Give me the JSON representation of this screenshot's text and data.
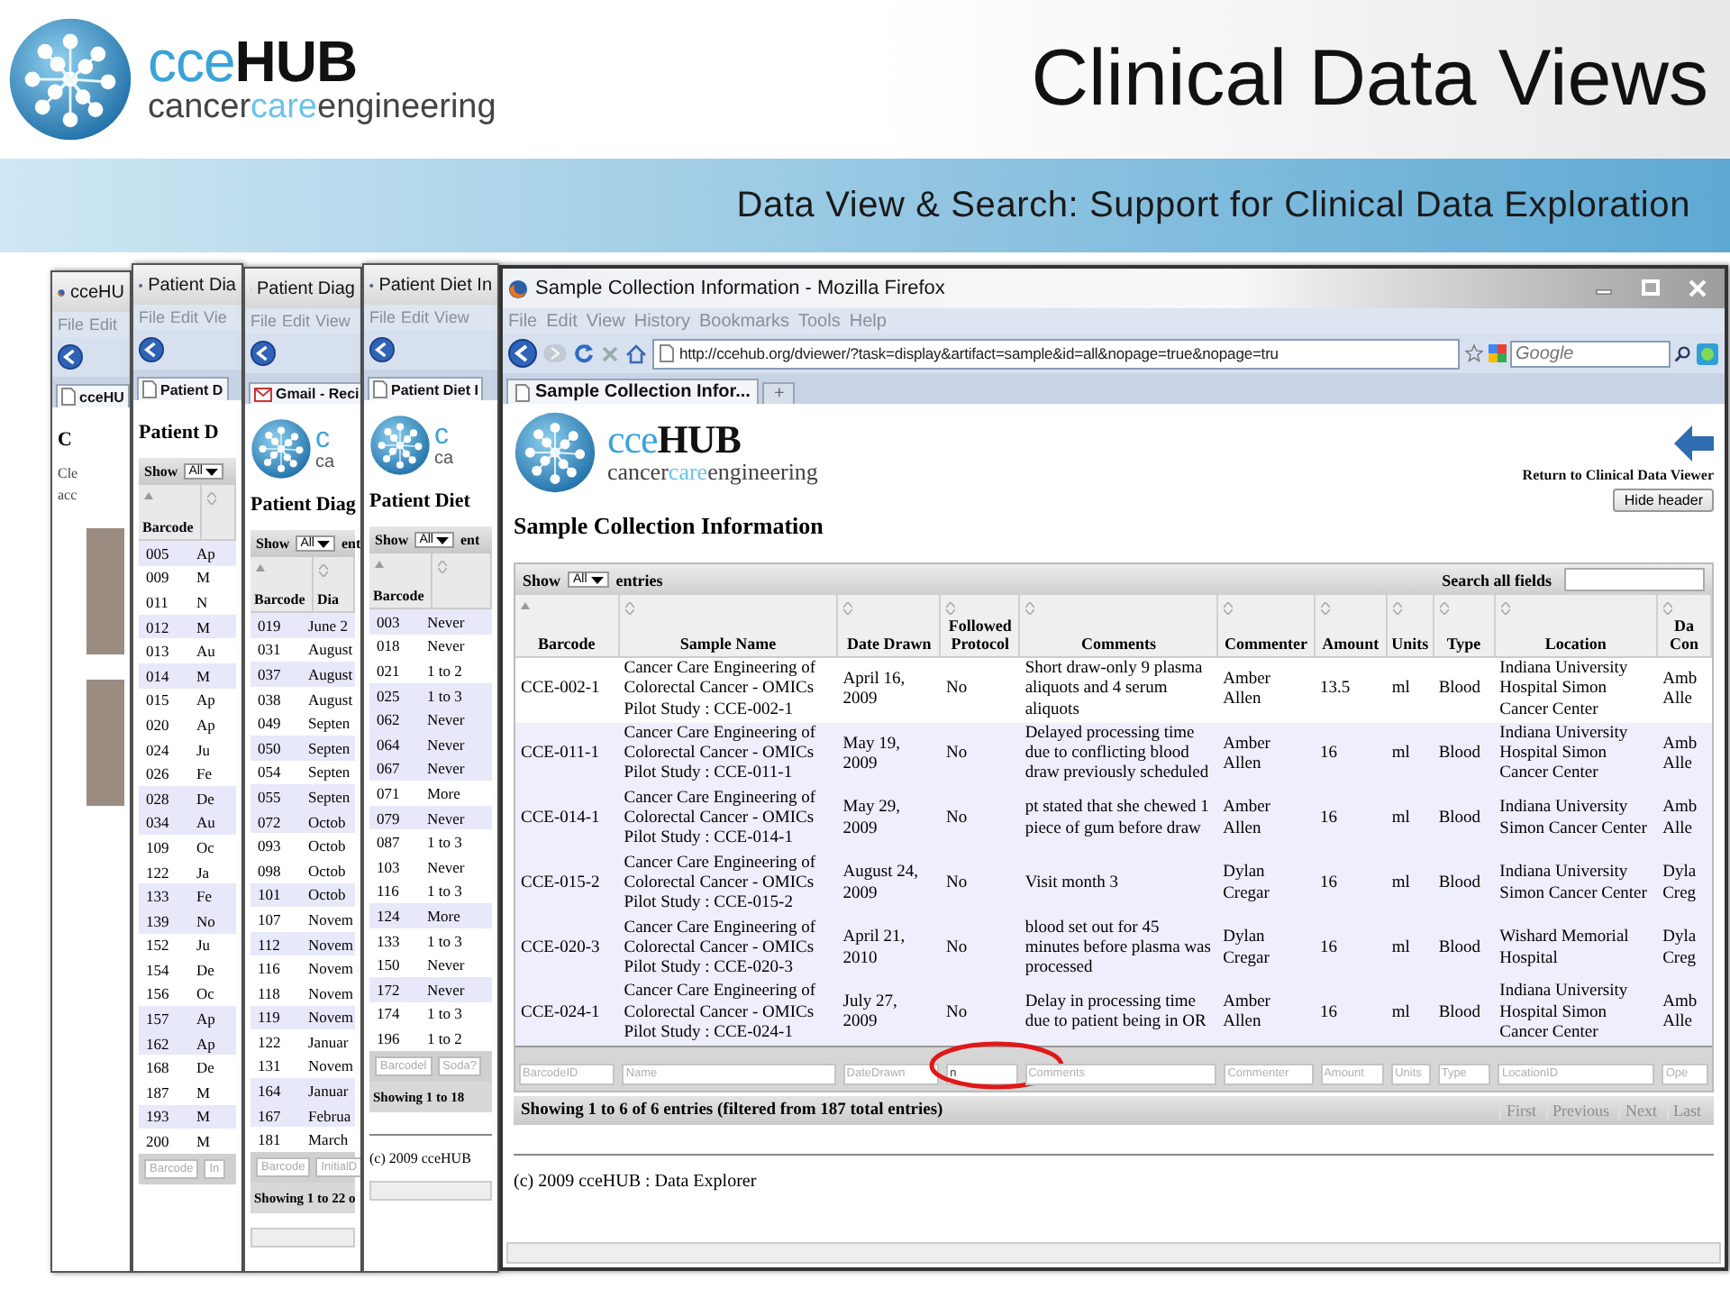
{
  "slide": {
    "logo": {
      "name": "cce**HUB**",
      "tagline": {
        "before": "cancer",
        "accent": "care",
        "after": "engineering"
      }
    },
    "title": "Clinical Data Views",
    "subtitle": "Data View & Search: Support for Clinical Data Exploration"
  },
  "background_windows": [
    {
      "title": "cceHU",
      "menu": [
        "File",
        "Edit"
      ],
      "tab": {
        "label": "cceHU",
        "kind": "page"
      },
      "heading": "C",
      "paragraph": [
        "Cle",
        "acc"
      ]
    },
    {
      "title": "Patient Dia",
      "menu": [
        "File",
        "Edit",
        "Vie"
      ],
      "tab": {
        "label": "Patient D",
        "kind": "page"
      },
      "heading": "Patient D",
      "show": {
        "label": "Show",
        "value": "All"
      },
      "columns": [
        {
          "label": "Barcode",
          "sorted": true
        },
        {
          "sorted": false
        }
      ],
      "rows": [
        {
          "shaded": true,
          "cells": [
            "005",
            "Ap"
          ]
        },
        {
          "shaded": false,
          "cells": [
            "009",
            "M"
          ]
        },
        {
          "shaded": false,
          "cells": [
            "011",
            "N"
          ]
        },
        {
          "shaded": true,
          "cells": [
            "012",
            "M"
          ]
        },
        {
          "shaded": false,
          "cells": [
            "013",
            "Au"
          ]
        },
        {
          "shaded": true,
          "cells": [
            "014",
            "M"
          ]
        },
        {
          "shaded": false,
          "cells": [
            "015",
            "Ap"
          ]
        },
        {
          "shaded": false,
          "cells": [
            "020",
            "Ap"
          ]
        },
        {
          "shaded": false,
          "cells": [
            "024",
            "Ju"
          ]
        },
        {
          "shaded": false,
          "cells": [
            "026",
            "Fe"
          ]
        },
        {
          "shaded": true,
          "cells": [
            "028",
            "De"
          ]
        },
        {
          "shaded": true,
          "cells": [
            "034",
            "Au"
          ]
        },
        {
          "shaded": false,
          "cells": [
            "109",
            "Oc"
          ]
        },
        {
          "shaded": false,
          "cells": [
            "122",
            "Ja"
          ]
        },
        {
          "shaded": true,
          "cells": [
            "133",
            "Fe"
          ]
        },
        {
          "shaded": true,
          "cells": [
            "139",
            "No"
          ]
        },
        {
          "shaded": false,
          "cells": [
            "152",
            "Ju"
          ]
        },
        {
          "shaded": false,
          "cells": [
            "154",
            "De"
          ]
        },
        {
          "shaded": false,
          "cells": [
            "156",
            "Oc"
          ]
        },
        {
          "shaded": true,
          "cells": [
            "157",
            "Ap"
          ]
        },
        {
          "shaded": true,
          "cells": [
            "162",
            "Ap"
          ]
        },
        {
          "shaded": false,
          "cells": [
            "168",
            "De"
          ]
        },
        {
          "shaded": false,
          "cells": [
            "187",
            "M"
          ]
        },
        {
          "shaded": true,
          "cells": [
            "193",
            "M"
          ]
        },
        {
          "shaded": false,
          "cells": [
            "200",
            "M"
          ]
        }
      ],
      "filters": [
        "Barcode",
        "In"
      ]
    },
    {
      "title": "Patient Diag",
      "menu": [
        "File",
        "Edit",
        "View"
      ],
      "tab": {
        "label": "Gmail - Reci",
        "kind": "mail"
      },
      "logo": {
        "name": "c",
        "tagline": "ca"
      },
      "heading": "Patient Diag",
      "show": {
        "label": "Show",
        "value": "All",
        "after": "ent"
      },
      "columns": [
        {
          "label": "Barcode",
          "sorted": true
        },
        {
          "label": "Dia",
          "sorted": false
        }
      ],
      "rows": [
        {
          "shaded": true,
          "cells": [
            "019",
            "June 2"
          ]
        },
        {
          "shaded": false,
          "cells": [
            "031",
            "August"
          ]
        },
        {
          "shaded": true,
          "cells": [
            "037",
            "August"
          ]
        },
        {
          "shaded": false,
          "cells": [
            "038",
            "August"
          ]
        },
        {
          "shaded": false,
          "cells": [
            "049",
            "Septen"
          ]
        },
        {
          "shaded": true,
          "cells": [
            "050",
            "Septen"
          ]
        },
        {
          "shaded": false,
          "cells": [
            "054",
            "Septen"
          ]
        },
        {
          "shaded": true,
          "cells": [
            "055",
            "Septen"
          ]
        },
        {
          "shaded": true,
          "cells": [
            "072",
            "Octob"
          ]
        },
        {
          "shaded": false,
          "cells": [
            "093",
            "Octob"
          ]
        },
        {
          "shaded": false,
          "cells": [
            "098",
            "Octob"
          ]
        },
        {
          "shaded": true,
          "cells": [
            "101",
            "Octob"
          ]
        },
        {
          "shaded": false,
          "cells": [
            "107",
            "Novem"
          ]
        },
        {
          "shaded": true,
          "cells": [
            "112",
            "Novem"
          ]
        },
        {
          "shaded": false,
          "cells": [
            "116",
            "Novem"
          ]
        },
        {
          "shaded": false,
          "cells": [
            "118",
            "Novem"
          ]
        },
        {
          "shaded": true,
          "cells": [
            "119",
            "Novem"
          ]
        },
        {
          "shaded": false,
          "cells": [
            "122",
            "Januar"
          ]
        },
        {
          "shaded": false,
          "cells": [
            "131",
            "Novem"
          ]
        },
        {
          "shaded": true,
          "cells": [
            "164",
            "Januar"
          ]
        },
        {
          "shaded": true,
          "cells": [
            "167",
            "Februa"
          ]
        },
        {
          "shaded": false,
          "cells": [
            "181",
            "March"
          ]
        }
      ],
      "filters": [
        "Barcode",
        "InitialD"
      ],
      "summary": "Showing 1 to 22 o"
    },
    {
      "title": "Patient Diet In",
      "menu": [
        "File",
        "Edit",
        "View"
      ],
      "tab": {
        "label": "Patient Diet I",
        "kind": "page"
      },
      "logo": {
        "name": "c",
        "tagline": "ca"
      },
      "heading": "Patient Diet",
      "show": {
        "label": "Show",
        "value": "All",
        "after": "ent"
      },
      "columns": [
        {
          "label": "Barcode",
          "sorted": true
        },
        {
          "sorted": false
        }
      ],
      "rows": [
        {
          "shaded": true,
          "cells": [
            "003",
            "Never"
          ]
        },
        {
          "shaded": false,
          "cells": [
            "018",
            "Never"
          ]
        },
        {
          "shaded": false,
          "cells": [
            "021",
            "1 to 2"
          ]
        },
        {
          "shaded": true,
          "cells": [
            "025",
            "1 to 3"
          ]
        },
        {
          "shaded": true,
          "cells": [
            "062",
            "Never"
          ]
        },
        {
          "shaded": true,
          "cells": [
            "064",
            "Never"
          ]
        },
        {
          "shaded": true,
          "cells": [
            "067",
            "Never"
          ]
        },
        {
          "shaded": false,
          "cells": [
            "071",
            "More"
          ]
        },
        {
          "shaded": true,
          "cells": [
            "079",
            "Never"
          ]
        },
        {
          "shaded": false,
          "cells": [
            "087",
            "1 to 3"
          ]
        },
        {
          "shaded": false,
          "cells": [
            "103",
            "Never"
          ]
        },
        {
          "shaded": false,
          "cells": [
            "116",
            "1 to 3"
          ]
        },
        {
          "shaded": true,
          "cells": [
            "124",
            "More"
          ]
        },
        {
          "shaded": false,
          "cells": [
            "133",
            "1 to 3"
          ]
        },
        {
          "shaded": false,
          "cells": [
            "150",
            "Never"
          ]
        },
        {
          "shaded": true,
          "cells": [
            "172",
            "Never"
          ]
        },
        {
          "shaded": false,
          "cells": [
            "174",
            "1 to 3"
          ]
        },
        {
          "shaded": false,
          "cells": [
            "196",
            "1 to 2"
          ]
        }
      ],
      "filters": [
        "Barcodel",
        "Soda?"
      ],
      "summary": "Showing 1 to 18",
      "copyright": "(c) 2009 cceHUB"
    }
  ],
  "browser": {
    "title": "Sample Collection Information - Mozilla Firefox",
    "menu": [
      "File",
      "Edit",
      "View",
      "History",
      "Bookmarks",
      "Tools",
      "Help"
    ],
    "url": "http://ccehub.org/dviewer/?task=display&artifact=sample&id=all&nopage=true&nopage=tru",
    "search_placeholder": "Google",
    "tabs": [
      {
        "label": "Sample Collection Infor...",
        "selected": true
      }
    ],
    "new_tab": "+",
    "page": {
      "logo": {
        "name": "cce**HUB**",
        "tagline": {
          "before": "cancer",
          "accent": "care",
          "after": "engineering"
        }
      },
      "return_link": "Return to Clinical Data Viewer",
      "hide_header": "Hide header",
      "heading": "Sample Collection Information",
      "show": {
        "label": "Show",
        "value": "All",
        "after": "entries"
      },
      "search_label": "Search all fields",
      "columns": [
        {
          "label": "Barcode",
          "sorted": true
        },
        {
          "label": "Sample Name",
          "sorted": false
        },
        {
          "label": "Date Drawn",
          "sorted": false
        },
        {
          "label": "Followed Protocol",
          "sorted": false
        },
        {
          "label": "Comments",
          "sorted": false
        },
        {
          "label": "Commenter",
          "sorted": false
        },
        {
          "label": "Amount",
          "sorted": false
        },
        {
          "label": "Units",
          "sorted": false
        },
        {
          "label": "Type",
          "sorted": false
        },
        {
          "label": "Location",
          "sorted": false
        },
        {
          "label": "Da Con",
          "sorted": false
        }
      ],
      "rows": [
        {
          "shaded": false,
          "cells": [
            "CCE-002-1",
            "Cancer Care Engineering of Colorectal Cancer - OMICs Pilot Study : CCE-002-1",
            "April 16, 2009",
            "No",
            "Short draw-only 9 plasma aliquots and 4 serum aliquots",
            "Amber Allen",
            "13.5",
            "ml",
            "Blood",
            "Indiana University Hospital Simon Cancer Center",
            "Amb Alle"
          ]
        },
        {
          "shaded": true,
          "cells": [
            "CCE-011-1",
            "Cancer Care Engineering of Colorectal Cancer - OMICs Pilot Study : CCE-011-1",
            "May 19, 2009",
            "No",
            "Delayed processing time due to conflicting blood draw previously scheduled",
            "Amber Allen",
            "16",
            "ml",
            "Blood",
            "Indiana University Hospital Simon Cancer Center",
            "Amb Alle"
          ]
        },
        {
          "shaded": true,
          "cells": [
            "CCE-014-1",
            "Cancer Care Engineering of Colorectal Cancer - OMICs Pilot Study : CCE-014-1",
            "May 29, 2009",
            "No",
            "pt stated that she chewed 1 piece of gum before draw",
            "Amber Allen",
            "16",
            "ml",
            "Blood",
            "Indiana University Simon Cancer Center",
            "Amb Alle"
          ]
        },
        {
          "shaded": true,
          "cells": [
            "CCE-015-2",
            "Cancer Care Engineering of Colorectal Cancer - OMICs Pilot Study : CCE-015-2",
            "August 24, 2009",
            "No",
            "Visit month 3",
            "Dylan Cregar",
            "16",
            "ml",
            "Blood",
            "Indiana University Simon Cancer Center",
            "Dyla Creg"
          ]
        },
        {
          "shaded": true,
          "cells": [
            "CCE-020-3",
            "Cancer Care Engineering of Colorectal Cancer - OMICs Pilot Study : CCE-020-3",
            "April 21, 2010",
            "No",
            "blood set out for 45 minutes before plasma was processed",
            "Dylan Cregar",
            "16",
            "ml",
            "Blood",
            "Wishard Memorial Hospital",
            "Dyla Creg"
          ]
        },
        {
          "shaded": true,
          "cells": [
            "CCE-024-1",
            "Cancer Care Engineering of Colorectal Cancer - OMICs Pilot Study : CCE-024-1",
            "July 27, 2009",
            "No",
            "Delay in processing time due to patient being in OR",
            "Amber Allen",
            "16",
            "ml",
            "Blood",
            "Indiana University Hospital Simon Cancer Center",
            "Amb Alle"
          ]
        }
      ],
      "filters": [
        {
          "placeholder": "BarcodeID",
          "highlighted": false
        },
        {
          "placeholder": "Name",
          "highlighted": false
        },
        {
          "placeholder": "DateDrawn",
          "highlighted": false
        },
        {
          "value": "n",
          "highlighted": true
        },
        {
          "placeholder": "Comments",
          "highlighted": false
        },
        {
          "placeholder": "Commenter",
          "highlighted": false
        },
        {
          "placeholder": "Amount",
          "highlighted": false
        },
        {
          "placeholder": "Units",
          "highlighted": false
        },
        {
          "placeholder": "Type",
          "highlighted": false
        },
        {
          "placeholder": "LocationID",
          "highlighted": false
        },
        {
          "placeholder": "Ope",
          "highlighted": false
        }
      ],
      "summary": "Showing 1 to 6 of 6 entries (filtered from 187 total entries)",
      "paging": [
        {
          "label": "First",
          "disabled": true
        },
        {
          "label": "Previous",
          "disabled": true
        },
        {
          "label": "Next",
          "disabled": true
        },
        {
          "label": "Last",
          "disabled": true
        }
      ],
      "copyright": "(c) 2009 cceHUB : Data Explorer"
    }
  }
}
